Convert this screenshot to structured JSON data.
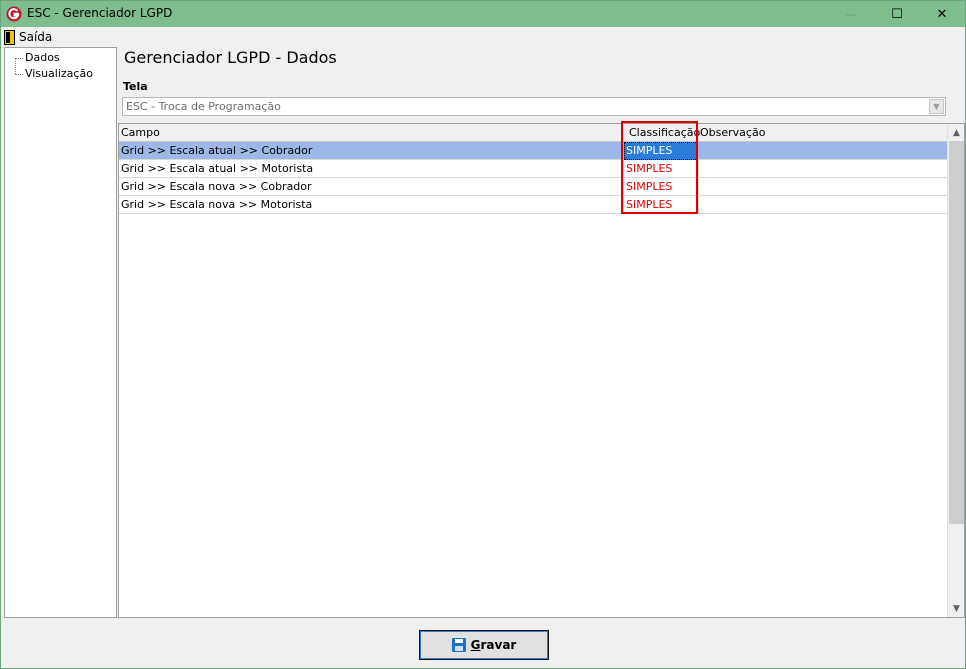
{
  "window": {
    "title": "ESC - Gerenciador LGPD",
    "minimize_glyph": "—",
    "maximize_glyph": "☐",
    "close_glyph": "✕"
  },
  "menu": {
    "items": [
      {
        "label": "Saída",
        "icon": "exit-door-icon"
      }
    ]
  },
  "tree": {
    "items": [
      {
        "label": "Dados"
      },
      {
        "label": "Visualização"
      }
    ]
  },
  "main": {
    "title": "Gerenciador LGPD - Dados",
    "tela_label": "Tela",
    "tela_value": "ESC - Troca de Programação"
  },
  "grid": {
    "columns": [
      "Campo",
      "Classificação",
      "Observação"
    ],
    "rows": [
      {
        "campo": "Grid >> Escala atual >> Cobrador",
        "classificacao": "SIMPLES",
        "observacao": "",
        "selected": true
      },
      {
        "campo": "Grid >> Escala atual >> Motorista",
        "classificacao": "SIMPLES",
        "observacao": ""
      },
      {
        "campo": "Grid >> Escala nova >> Cobrador",
        "classificacao": "SIMPLES",
        "observacao": ""
      },
      {
        "campo": "Grid >> Escala nova >> Motorista",
        "classificacao": "SIMPLES",
        "observacao": ""
      }
    ]
  },
  "footer": {
    "save_label": "Gravar",
    "save_icon": "floppy-disk-icon"
  },
  "colors": {
    "titlebar": "#7dbd8e",
    "selected_row": "#9db7e8",
    "selected_cell": "#2b7bd8",
    "classification_text": "#e00000",
    "highlight_box": "#e00000"
  }
}
